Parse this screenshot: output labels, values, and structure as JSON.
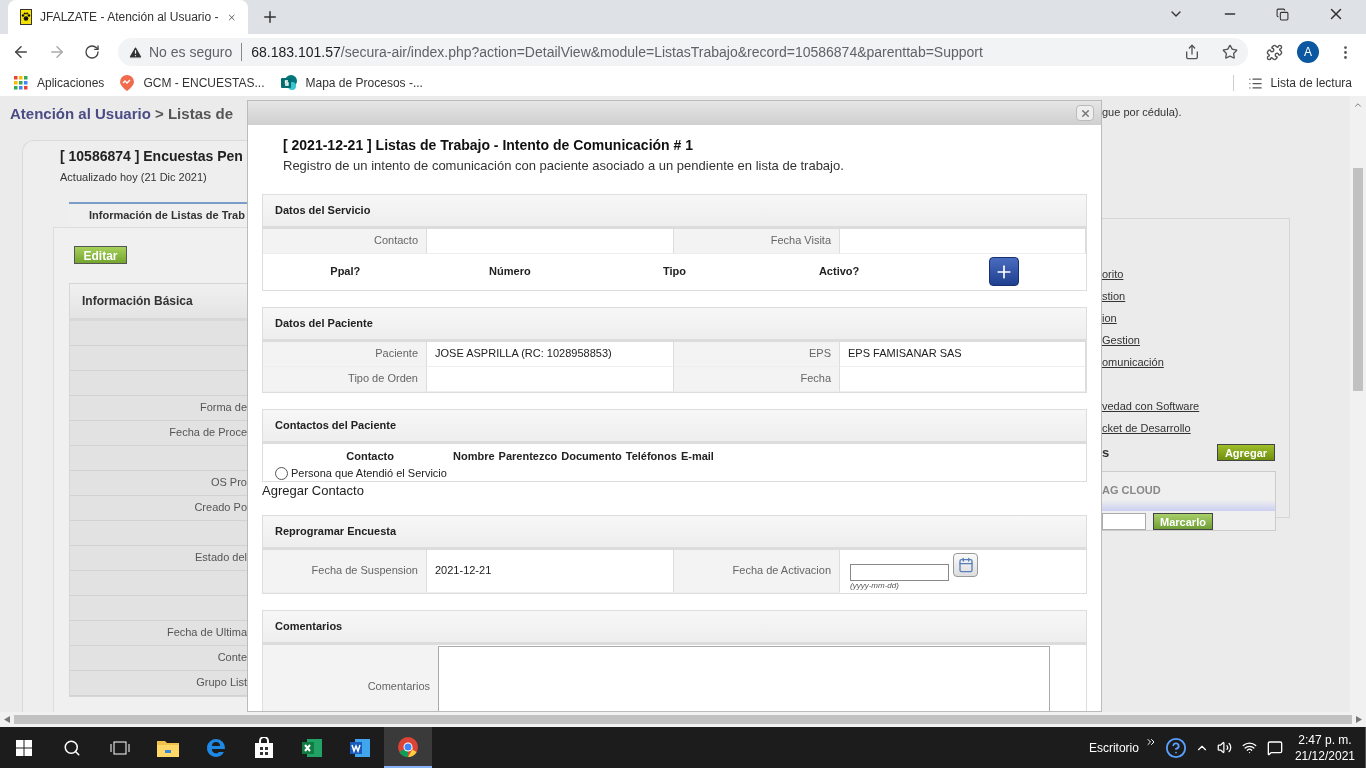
{
  "browser": {
    "tab": {
      "title": "JFALZATE - Atención al Usuario -",
      "selected": true
    },
    "address": {
      "security": "No es seguro",
      "host": "68.183.101.57",
      "path": "/secura-air/index.php?action=DetailView&module=ListasTrabajo&record=10586874&parenttab=Support"
    },
    "profile_initial": "A",
    "bookmarks": [
      {
        "kind": "apps",
        "label": "Aplicaciones"
      },
      {
        "kind": "survey",
        "label": "GCM - ENCUESTAS..."
      },
      {
        "kind": "sharepoint",
        "label": "Mapa de Procesos -..."
      }
    ],
    "reading_list": "Lista de lectura"
  },
  "page": {
    "breadcrumb": {
      "module": "Atención al Usuario",
      "current": "> Listas de"
    },
    "record_title": "[ 10586874 ] Encuestas Pen",
    "updated": "Actualizado hoy (21 Dic 2021)",
    "tab": {
      "label": "Información de Listas de Trab",
      "selected": true
    },
    "edit_button": "Editar",
    "basic_info": {
      "title": "Información Básica",
      "rows": [
        {},
        {},
        {},
        {
          "label": "Forma de"
        },
        {
          "label": "Fecha de Proce"
        },
        {},
        {
          "label": "OS Pro"
        },
        {
          "label": "Creado Po"
        },
        {},
        {
          "label": "Estado del"
        },
        {},
        {},
        {
          "label": "Fecha de Ultima"
        },
        {
          "label": "Conte"
        },
        {
          "label": "Grupo List"
        }
      ]
    },
    "side_note": "gue por cédula).",
    "link_groups": [
      [
        {
          "label": "orito"
        },
        {
          "label": "stion"
        },
        {
          "label": "ion"
        },
        {
          "label": "Gestion"
        },
        {
          "label": "omunicación"
        }
      ],
      [
        {
          "label": "vedad con Software"
        },
        {
          "label": "cket de Desarrollo"
        }
      ]
    ],
    "tags_title": "s",
    "add_button": "Agregar",
    "tag_cloud": "AG CLOUD",
    "mark_button": "Marcarlo"
  },
  "modal": {
    "title": "[ 2021-12-21 ] Listas de Trabajo - Intento de Comunicación # 1",
    "description": "Registro de un intento de comunicación con paciente asociado a un pendiente en lista de trabajo.",
    "sections": [
      {
        "kind": "service",
        "title": "Datos del Servicio",
        "fields": [
          {
            "label": "Contacto"
          },
          {
            "label": "Fecha Visita"
          }
        ],
        "columns": [
          "Ppal?",
          "Número",
          "Tipo",
          "Activo?"
        ]
      },
      {
        "kind": "grid",
        "title": "Datos del Paciente",
        "fields": [
          {
            "label": "Paciente",
            "value": "JOSE ASPRILLA (RC: 1028958853)"
          },
          {
            "label": "EPS",
            "value": "EPS FAMISANAR SAS"
          },
          {
            "label": "Tipo de Orden"
          },
          {
            "label": "Fecha"
          }
        ]
      },
      {
        "kind": "contacts",
        "title": "Contactos del Paciente",
        "columns": [
          "Contacto",
          "Nombre",
          "Parentezco",
          "Documento",
          "Teléfonos",
          "E-mail"
        ],
        "option": {
          "label": "Persona que Atendió el Servicio",
          "selected": false
        },
        "add_link": "Agregar Contacto"
      },
      {
        "kind": "reschedule",
        "title": "Reprogramar Encuesta",
        "fields": [
          {
            "label": "Fecha de Suspension",
            "value": "2021-12-21"
          },
          {
            "label": "Fecha de Activacion",
            "hint": "(yyyy-mm-dd)"
          }
        ]
      },
      {
        "kind": "comments",
        "title": "Comentarios",
        "field": {
          "label": "Comentarios"
        }
      }
    ]
  },
  "taskbar": {
    "apps": [
      {
        "kind": "explorer",
        "selected": false
      },
      {
        "kind": "edge",
        "selected": false
      },
      {
        "kind": "store",
        "selected": false
      },
      {
        "kind": "excel",
        "selected": false
      },
      {
        "kind": "word",
        "selected": false
      },
      {
        "kind": "chrome",
        "selected": true
      }
    ],
    "desktop": "Escritorio",
    "time": "2:47 p. m.",
    "date": "21/12/2021"
  }
}
